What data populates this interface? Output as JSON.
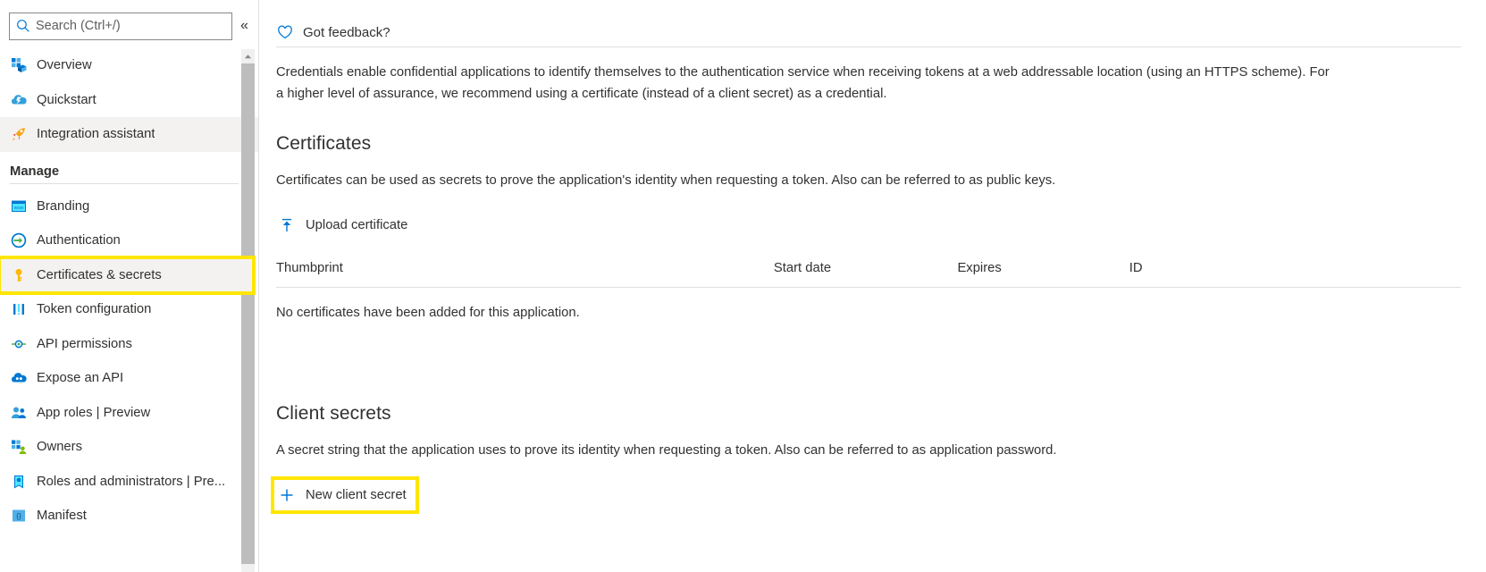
{
  "sidebar": {
    "search": {
      "placeholder": "Search (Ctrl+/)",
      "value": ""
    },
    "collapse_label": "«",
    "items_top": [
      {
        "label": "Overview",
        "icon": "overview-grid-icon"
      },
      {
        "label": "Quickstart",
        "icon": "quickstart-cloud-icon"
      },
      {
        "label": "Integration assistant",
        "icon": "rocket-icon"
      }
    ],
    "group_title": "Manage",
    "items_manage": [
      {
        "label": "Branding",
        "icon": "branding-window-icon"
      },
      {
        "label": "Authentication",
        "icon": "authentication-arrow-icon"
      },
      {
        "label": "Certificates & secrets",
        "icon": "key-icon"
      },
      {
        "label": "Token configuration",
        "icon": "token-bars-icon"
      },
      {
        "label": "API permissions",
        "icon": "api-permissions-icon"
      },
      {
        "label": "Expose an API",
        "icon": "expose-api-cloud-icon"
      },
      {
        "label": "App roles | Preview",
        "icon": "app-roles-people-icon"
      },
      {
        "label": "Owners",
        "icon": "owners-grid-icon"
      },
      {
        "label": "Roles and administrators | Pre...",
        "icon": "roles-admin-icon"
      },
      {
        "label": "Manifest",
        "icon": "manifest-braces-icon"
      }
    ],
    "selected_item": "Certificates & secrets",
    "highlight_color": "#ffe600"
  },
  "main": {
    "feedback": {
      "label": "Got feedback?",
      "icon": "heart-icon"
    },
    "intro": "Credentials enable confidential applications to identify themselves to the authentication service when receiving tokens at a web addressable location (using an HTTPS scheme). For a higher level of assurance, we recommend using a certificate (instead of a client secret) as a credential.",
    "certificates": {
      "title": "Certificates",
      "description": "Certificates can be used as secrets to prove the application's identity when requesting a token. Also can be referred to as public keys.",
      "upload_button": "Upload certificate",
      "upload_icon": "upload-icon",
      "columns": [
        "Thumbprint",
        "Start date",
        "Expires",
        "ID"
      ],
      "empty_message": "No certificates have been added for this application.",
      "rows": []
    },
    "client_secrets": {
      "title": "Client secrets",
      "description": "A secret string that the application uses to prove its identity when requesting a token. Also can be referred to as application password.",
      "new_button": "New client secret",
      "new_icon": "plus-icon"
    }
  }
}
